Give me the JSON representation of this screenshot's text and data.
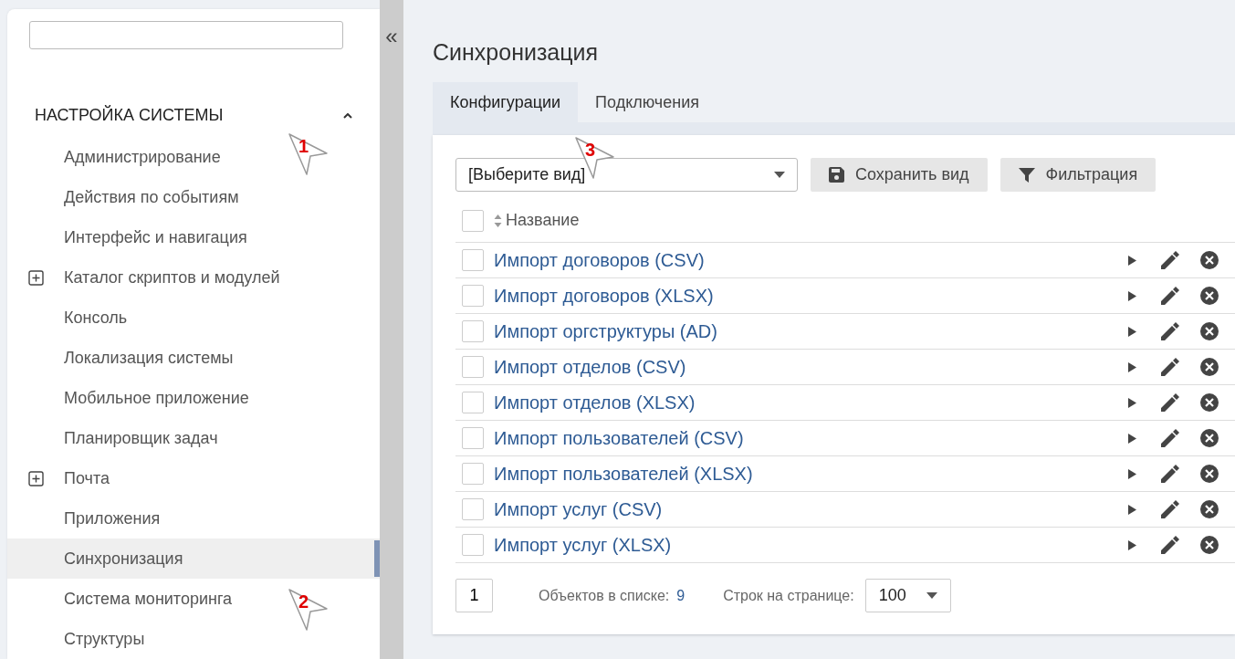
{
  "sidebar": {
    "collapse_icon": "«",
    "section": {
      "title": "НАСТРОЙКА СИСТЕМЫ",
      "expanded": true,
      "items": [
        {
          "label": "Администрирование",
          "has_children": false,
          "selected": false
        },
        {
          "label": "Действия по событиям",
          "has_children": false,
          "selected": false
        },
        {
          "label": "Интерфейс и навигация",
          "has_children": false,
          "selected": false
        },
        {
          "label": "Каталог скриптов и модулей",
          "has_children": true,
          "selected": false
        },
        {
          "label": "Консоль",
          "has_children": false,
          "selected": false
        },
        {
          "label": "Локализация системы",
          "has_children": false,
          "selected": false
        },
        {
          "label": "Мобильное приложение",
          "has_children": false,
          "selected": false
        },
        {
          "label": "Планировщик задач",
          "has_children": false,
          "selected": false
        },
        {
          "label": "Почта",
          "has_children": true,
          "selected": false
        },
        {
          "label": "Приложения",
          "has_children": false,
          "selected": false
        },
        {
          "label": "Синхронизация",
          "has_children": false,
          "selected": true
        },
        {
          "label": "Система мониторинга",
          "has_children": false,
          "selected": false
        },
        {
          "label": "Структуры",
          "has_children": false,
          "selected": false
        }
      ]
    }
  },
  "page": {
    "title": "Синхронизация",
    "tabs": [
      {
        "label": "Конфигурации",
        "selected": true
      },
      {
        "label": "Подключения",
        "selected": false
      }
    ],
    "toolbar": {
      "view_select": "[Выберите вид]",
      "save_button": "Сохранить вид",
      "filter_button": "Фильтрация"
    },
    "table": {
      "column": "Название",
      "header_checked": false,
      "rows": [
        {
          "name": "Импорт договоров (CSV)",
          "checked": false
        },
        {
          "name": "Импорт договоров (XLSX)",
          "checked": false
        },
        {
          "name": "Импорт оргструктуры (AD)",
          "checked": false
        },
        {
          "name": "Импорт отделов (CSV)",
          "checked": false
        },
        {
          "name": "Импорт отделов (XLSX)",
          "checked": false
        },
        {
          "name": "Импорт пользователей (CSV)",
          "checked": false
        },
        {
          "name": "Импорт пользователей (XLSX)",
          "checked": false
        },
        {
          "name": "Импорт услуг (CSV)",
          "checked": false
        },
        {
          "name": "Импорт услуг (XLSX)",
          "checked": false
        }
      ]
    },
    "footer": {
      "page": "1",
      "count_label": "Объектов в списке:",
      "count": "9",
      "per_page_label": "Строк на странице:",
      "per_page": "100"
    }
  },
  "callouts": [
    {
      "label": "1"
    },
    {
      "label": "2"
    },
    {
      "label": "3"
    }
  ]
}
